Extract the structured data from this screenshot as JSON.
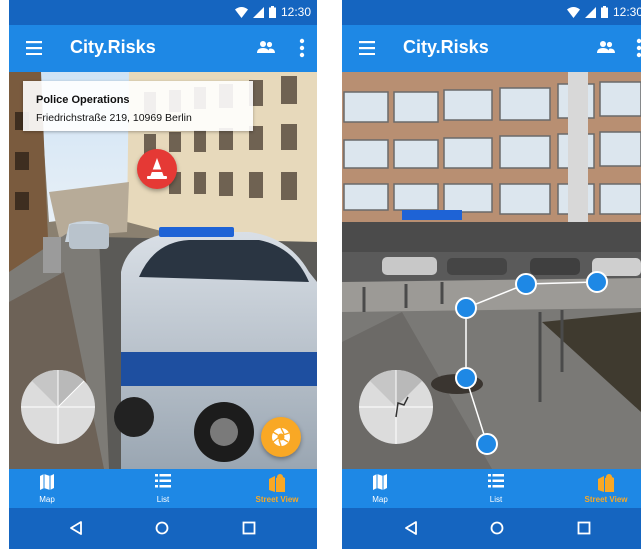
{
  "colors": {
    "status_bar": "#1565c0",
    "app_bar": "#1e88e5",
    "accent_orange": "#f9a825",
    "hazard_red": "#e53935",
    "waypoint_blue": "#1e88e5"
  },
  "screens": [
    {
      "status": {
        "time": "12:30"
      },
      "app_bar": {
        "title": "City.Risks",
        "icons": [
          "menu-icon",
          "people-icon",
          "more-vert-icon"
        ]
      },
      "info_card": {
        "name": "Police Operations",
        "address": "Friedrichstraße 219, 10969 Berlin"
      },
      "hazard_marker": {
        "icon": "hazard-cone-icon"
      },
      "camera_button": {
        "icon": "camera-aperture-icon"
      },
      "bottom_nav": [
        {
          "label": "Map",
          "icon": "map-icon"
        },
        {
          "label": "List",
          "icon": "list-icon"
        },
        {
          "label": "Street View",
          "icon": "street-view-icon",
          "active": true
        }
      ],
      "system_nav": [
        "back-icon",
        "home-icon",
        "recents-icon"
      ]
    },
    {
      "status": {
        "time": "12:30"
      },
      "app_bar": {
        "title": "City.Risks",
        "icons": [
          "menu-icon",
          "people-icon",
          "more-vert-icon"
        ]
      },
      "route_waypoints": 5,
      "bottom_nav": [
        {
          "label": "Map",
          "icon": "map-icon"
        },
        {
          "label": "List",
          "icon": "list-icon"
        },
        {
          "label": "Street View",
          "icon": "street-view-icon",
          "active": true
        }
      ],
      "system_nav": [
        "back-icon",
        "home-icon",
        "recents-icon"
      ]
    }
  ]
}
